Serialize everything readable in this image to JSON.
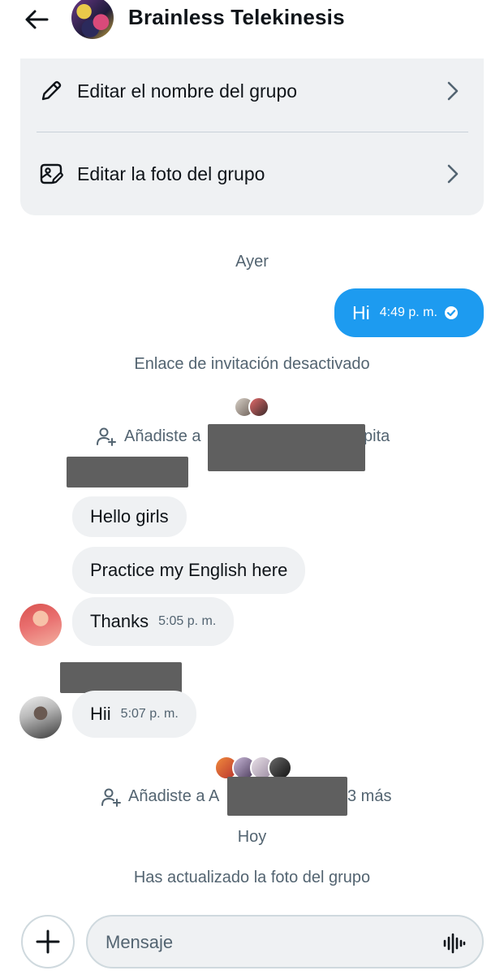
{
  "header": {
    "title": "Brainless Telekinesis",
    "back_icon": "arrow-left-icon"
  },
  "options": [
    {
      "label": "Editar el nombre del grupo",
      "icon": "pencil-icon"
    },
    {
      "label": "Editar la foto del grupo",
      "icon": "photo-edit-icon"
    }
  ],
  "conversation": {
    "date_yesterday": "Ayer",
    "outgoing": {
      "text": "Hi",
      "time": "4:49 p. m."
    },
    "invite_disabled": "Enlace de invitación desactivado",
    "added_1": {
      "prefix": "Añadiste a",
      "suffix": "pita"
    },
    "incoming_group_1": [
      "Hello girls",
      "Practice my English here"
    ],
    "incoming_thanks": {
      "text": "Thanks",
      "time": "5:05 p. m."
    },
    "incoming_hii": {
      "text": "Hii",
      "time": "5:07 p. m."
    },
    "added_2": {
      "prefix": "Añadiste a A",
      "suffix": "3 más"
    },
    "date_today": "Hoy",
    "photo_updated": "Has actualizado la foto del grupo"
  },
  "composer": {
    "placeholder": "Mensaje"
  },
  "colors": {
    "accent": "#1d9bf0",
    "bubble_in": "#eff1f3",
    "muted_text": "#536471"
  }
}
